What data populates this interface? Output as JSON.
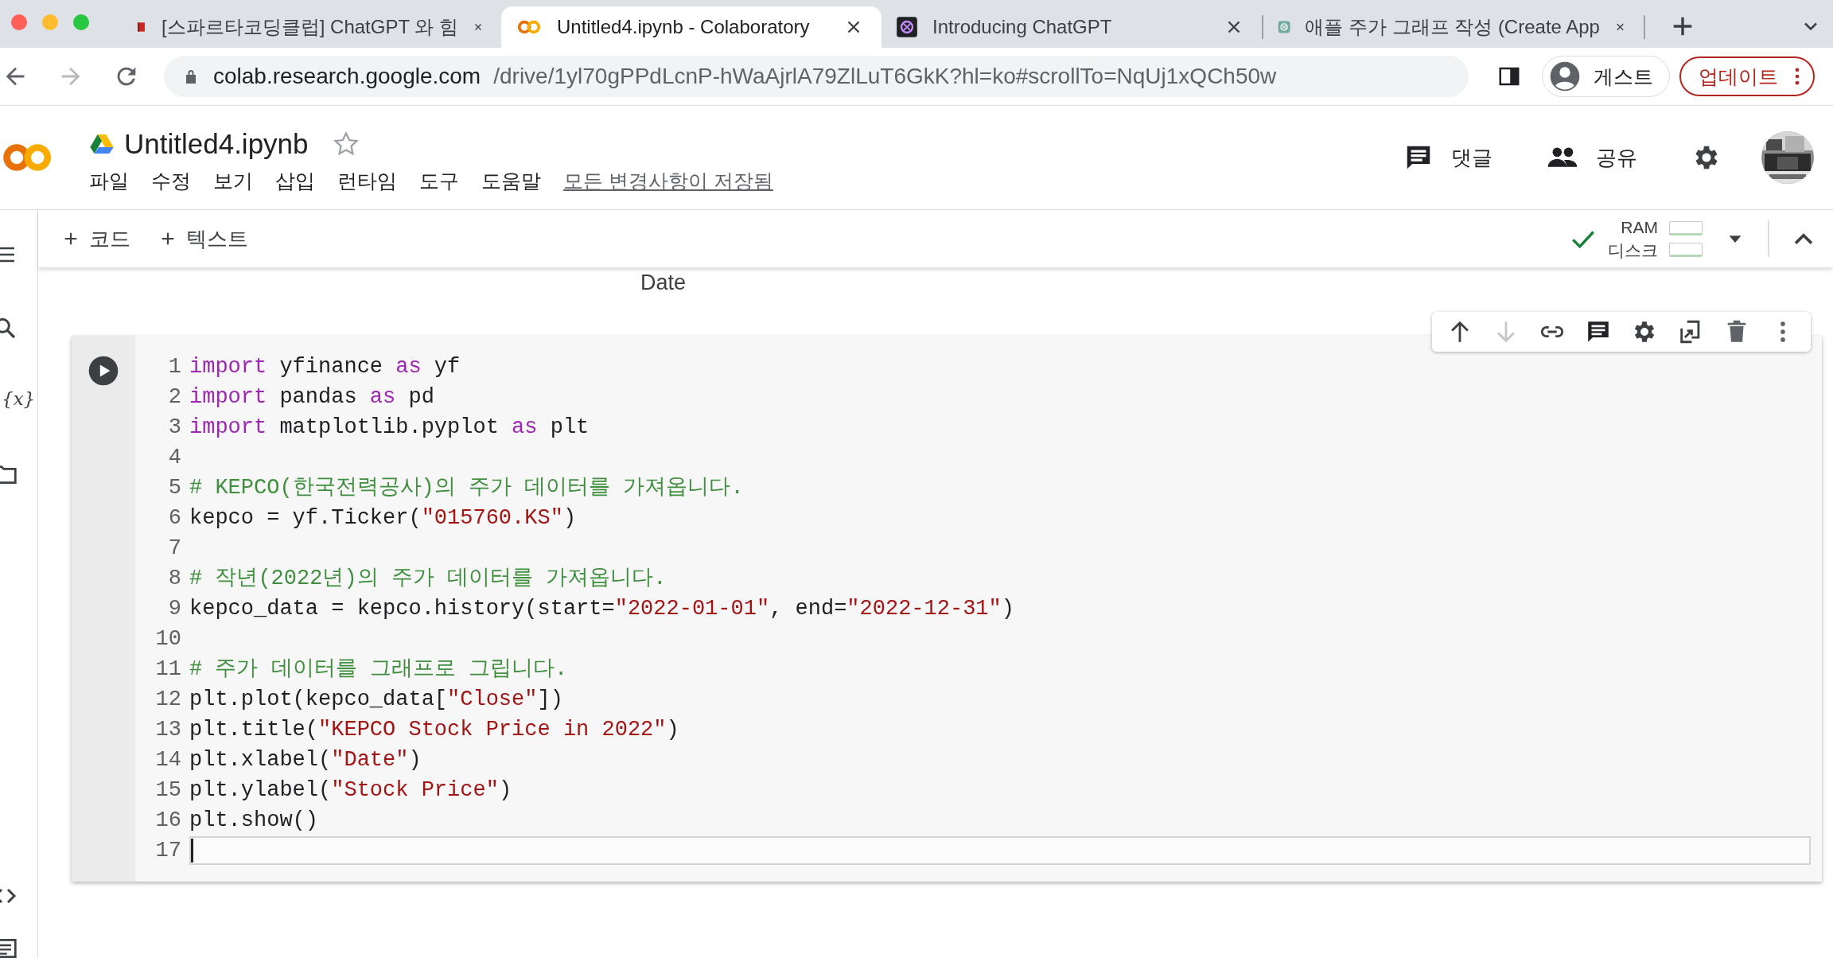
{
  "browser": {
    "tabs": [
      {
        "title": "[스파르타코딩클럽] ChatGPT 와 힘",
        "kind": "book",
        "selected": false
      },
      {
        "title": "Untitled4.ipynb - Colaboratory",
        "kind": "colab",
        "selected": true
      },
      {
        "title": "Introducing ChatGPT",
        "kind": "knot-dark",
        "selected": false
      },
      {
        "title": "애플 주가 그래프 작성 (Create App",
        "kind": "knot-green",
        "selected": false
      }
    ],
    "url_host": "colab.research.google.com",
    "url_path": "/drive/1yl70gPPdLcnP-hWaAjrlA79ZlLuT6GkK?hl=ko#scrollTo=NqUj1xQCh50w",
    "profile": "게스트",
    "update": "업데이트"
  },
  "notebook": {
    "title": "Untitled4.ipynb",
    "starred": false,
    "menu": [
      "파일",
      "수정",
      "보기",
      "삽입",
      "런타임",
      "도구",
      "도움말"
    ],
    "save_status": "모든 변경사항이 저장됨",
    "comment": "댓글",
    "share": "공유"
  },
  "toolbar": {
    "add_code": "코드",
    "add_text": "텍스트",
    "ram": "RAM",
    "disk": "디스크",
    "connected": true
  },
  "sidebar": {
    "variables_glyph": "{x}"
  },
  "output_label": "Date",
  "cell": {
    "move_down_disabled": true,
    "lines": [
      {
        "number": "1",
        "active": false,
        "tokens": [
          {
            "kind": "keyword",
            "text": "import"
          },
          {
            "kind": "plain",
            "text": " yfinance "
          },
          {
            "kind": "keyword",
            "text": "as"
          },
          {
            "kind": "plain",
            "text": " yf"
          }
        ]
      },
      {
        "number": "2",
        "active": false,
        "tokens": [
          {
            "kind": "keyword",
            "text": "import"
          },
          {
            "kind": "plain",
            "text": " pandas "
          },
          {
            "kind": "keyword",
            "text": "as"
          },
          {
            "kind": "plain",
            "text": " pd"
          }
        ]
      },
      {
        "number": "3",
        "active": false,
        "tokens": [
          {
            "kind": "keyword",
            "text": "import"
          },
          {
            "kind": "plain",
            "text": " matplotlib.pyplot "
          },
          {
            "kind": "keyword",
            "text": "as"
          },
          {
            "kind": "plain",
            "text": " plt"
          }
        ]
      },
      {
        "number": "4",
        "active": false
      },
      {
        "number": "5",
        "active": false,
        "tokens": [
          {
            "kind": "comment",
            "text": "# KEPCO(한국전력공사)의 주가 데이터를 가져옵니다."
          }
        ]
      },
      {
        "number": "6",
        "active": false,
        "tokens": [
          {
            "kind": "plain",
            "text": "kepco = yf.Ticker("
          },
          {
            "kind": "string",
            "text": "\"015760.KS\""
          },
          {
            "kind": "plain",
            "text": ")"
          }
        ]
      },
      {
        "number": "7",
        "active": false
      },
      {
        "number": "8",
        "active": false,
        "tokens": [
          {
            "kind": "comment",
            "text": "# 작년(2022년)의 주가 데이터를 가져옵니다."
          }
        ]
      },
      {
        "number": "9",
        "active": false,
        "tokens": [
          {
            "kind": "plain",
            "text": "kepco_data = kepco.history(start="
          },
          {
            "kind": "string",
            "text": "\"2022-01-01\""
          },
          {
            "kind": "plain",
            "text": ", end="
          },
          {
            "kind": "string",
            "text": "\"2022-12-31\""
          },
          {
            "kind": "plain",
            "text": ")"
          }
        ]
      },
      {
        "number": "10",
        "active": false
      },
      {
        "number": "11",
        "active": false,
        "tokens": [
          {
            "kind": "comment",
            "text": "# 주가 데이터를 그래프로 그립니다."
          }
        ]
      },
      {
        "number": "12",
        "active": false,
        "tokens": [
          {
            "kind": "plain",
            "text": "plt.plot(kepco_data["
          },
          {
            "kind": "string",
            "text": "\"Close\""
          },
          {
            "kind": "plain",
            "text": "])"
          }
        ]
      },
      {
        "number": "13",
        "active": false,
        "tokens": [
          {
            "kind": "plain",
            "text": "plt.title("
          },
          {
            "kind": "string",
            "text": "\"KEPCO Stock Price in 2022\""
          },
          {
            "kind": "plain",
            "text": ")"
          }
        ]
      },
      {
        "number": "14",
        "active": false,
        "tokens": [
          {
            "kind": "plain",
            "text": "plt.xlabel("
          },
          {
            "kind": "string",
            "text": "\"Date\""
          },
          {
            "kind": "plain",
            "text": ")"
          }
        ]
      },
      {
        "number": "15",
        "active": false,
        "tokens": [
          {
            "kind": "plain",
            "text": "plt.ylabel("
          },
          {
            "kind": "string",
            "text": "\"Stock Price\""
          },
          {
            "kind": "plain",
            "text": ")"
          }
        ]
      },
      {
        "number": "16",
        "active": false,
        "tokens": [
          {
            "kind": "plain",
            "text": "plt.show()"
          }
        ]
      },
      {
        "number": "17",
        "active": true
      }
    ]
  }
}
